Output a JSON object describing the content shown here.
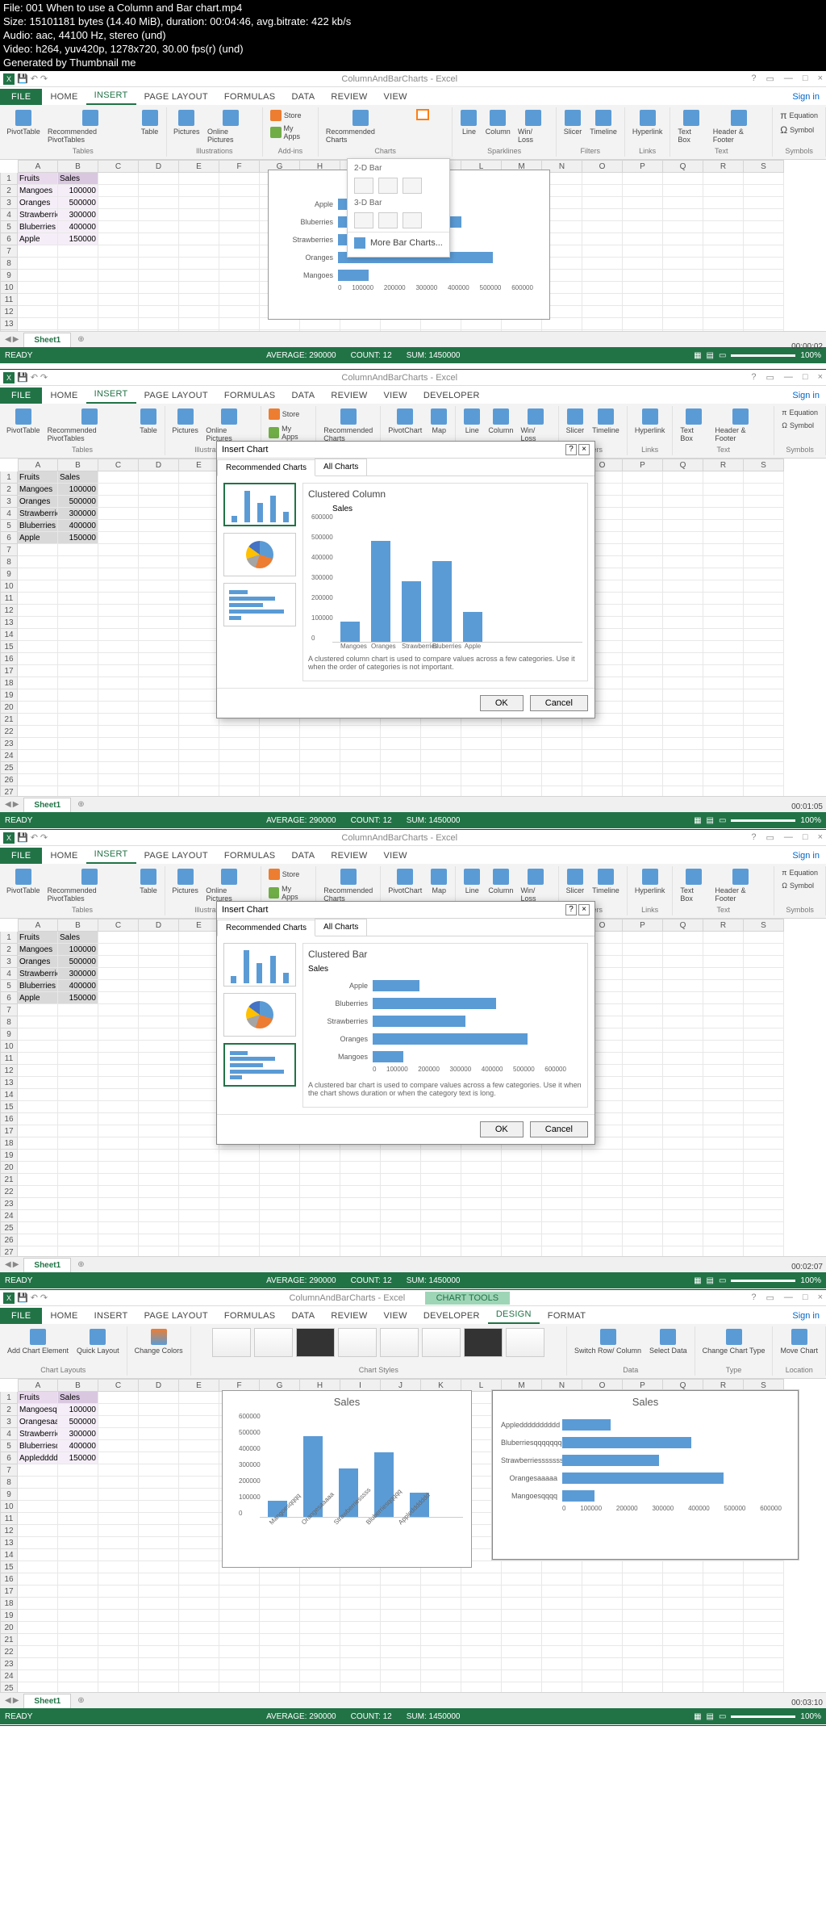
{
  "video_meta": {
    "file": "File: 001 When to use a Column and Bar chart.mp4",
    "size": "Size: 15101181 bytes (14.40 MiB), duration: 00:04:46, avg.bitrate: 422 kb/s",
    "audio": "Audio: aac, 44100 Hz, stereo (und)",
    "video": "Video: h264, yuv420p, 1278x720, 30.00 fps(r) (und)",
    "gen": "Generated by Thumbnail me"
  },
  "app_title": "ColumnAndBarCharts - Excel",
  "sign_in": "Sign in",
  "tabs_insert": {
    "file": "FILE",
    "home": "HOME",
    "insert": "INSERT",
    "pagelayout": "PAGE LAYOUT",
    "formulas": "FORMULAS",
    "data": "DATA",
    "review": "REVIEW",
    "view": "VIEW",
    "developer": "DEVELOPER"
  },
  "tabs_design": {
    "charttools": "CHART TOOLS",
    "design": "DESIGN",
    "format": "FORMAT"
  },
  "ribbon": {
    "groups": {
      "tables": "Tables",
      "illustrations": "Illustrations",
      "addins": "Add-ins",
      "charts": "Charts",
      "sparklines": "Sparklines",
      "filters": "Filters",
      "links": "Links",
      "text": "Text",
      "symbols": "Symbols",
      "data": "Data",
      "type": "Type",
      "location": "Location",
      "chartlayouts": "Chart Layouts",
      "chartstyles": "Chart Styles"
    },
    "btns": {
      "pivottable": "PivotTable",
      "recpivot": "Recommended PivotTables",
      "table": "Table",
      "pictures": "Pictures",
      "online": "Online Pictures",
      "store": "Store",
      "myapps": "My Apps",
      "reccharts": "Recommended Charts",
      "pivotchart": "PivotChart",
      "map": "Map",
      "line": "Line",
      "column": "Column",
      "winloss": "Win/ Loss",
      "slicer": "Slicer",
      "timeline": "Timeline",
      "hyperlink": "Hyperlink",
      "textbox": "Text Box",
      "header": "Header & Footer",
      "equation": "Equation",
      "symbol": "Symbol",
      "addchart": "Add Chart Element",
      "quicklayout": "Quick Layout",
      "changecolors": "Change Colors",
      "switchrowcol": "Switch Row/ Column",
      "selectdata": "Select Data",
      "changecharttype": "Change Chart Type",
      "movechart": "Move Chart"
    }
  },
  "chart_dd": {
    "bar2d": "2-D Bar",
    "bar3d": "3-D Bar",
    "more": "More Bar Charts..."
  },
  "columns": [
    "A",
    "B",
    "C",
    "D",
    "E",
    "F",
    "G",
    "H",
    "I",
    "J",
    "K",
    "L",
    "M",
    "N",
    "O",
    "P",
    "Q",
    "R",
    "S"
  ],
  "table_data": {
    "headers": [
      "Fruits",
      "Sales"
    ],
    "rows": [
      [
        "Mangoes",
        "100000"
      ],
      [
        "Oranges",
        "500000"
      ],
      [
        "Strawberries",
        "300000"
      ],
      [
        "Bluberries",
        "400000"
      ],
      [
        "Apple",
        "150000"
      ]
    ]
  },
  "table_data_long": {
    "headers": [
      "Fruits",
      "Sales"
    ],
    "rows": [
      [
        "Mangoesqqq",
        "100000"
      ],
      [
        "Orangesaaaa",
        "500000"
      ],
      [
        "Strawberries",
        "300000"
      ],
      [
        "Bluberriesqq",
        "400000"
      ],
      [
        "Appledddddc",
        "150000"
      ]
    ]
  },
  "chart_data": [
    {
      "panel": 1,
      "type": "bar",
      "title": "Sales",
      "categories": [
        "Apple",
        "Bluberries",
        "Strawberries",
        "Oranges",
        "Mangoes"
      ],
      "values": [
        150000,
        400000,
        300000,
        500000,
        100000
      ],
      "xlim": [
        0,
        600000
      ],
      "ticks": [
        "0",
        "100000",
        "200000",
        "300000",
        "400000",
        "500000",
        "600000"
      ]
    },
    {
      "panel": 2,
      "type": "bar_vertical",
      "title": "Sales",
      "chart_name": "Clustered Column",
      "categories": [
        "Mangoes",
        "Oranges",
        "Strawberries",
        "Bluberries",
        "Apple"
      ],
      "values": [
        100000,
        500000,
        300000,
        400000,
        150000
      ],
      "ylim": [
        0,
        600000
      ],
      "ticks": [
        "0",
        "100000",
        "200000",
        "300000",
        "400000",
        "500000",
        "600000"
      ],
      "desc": "A clustered column chart is used to compare values across a few categories. Use it when the order of categories is not important."
    },
    {
      "panel": 3,
      "type": "bar",
      "title": "Sales",
      "chart_name": "Clustered Bar",
      "categories": [
        "Apple",
        "Bluberries",
        "Strawberries",
        "Oranges",
        "Mangoes"
      ],
      "values": [
        150000,
        400000,
        300000,
        500000,
        100000
      ],
      "xlim": [
        0,
        600000
      ],
      "ticks": [
        "0",
        "100000",
        "200000",
        "300000",
        "400000",
        "500000",
        "600000"
      ],
      "desc": "A clustered bar chart is used to compare values across a few categories. Use it when the chart shows duration or when the category text is long."
    },
    {
      "panel": 4,
      "sub": "col",
      "type": "bar_vertical",
      "title": "Sales",
      "categories": [
        "Mangoesqqqq",
        "Orangesaaaaa",
        "Strawberriesssss",
        "Bluberriesqqqqq",
        "Appleddddddd"
      ],
      "values": [
        100000,
        500000,
        300000,
        400000,
        150000
      ],
      "ylim": [
        0,
        600000
      ],
      "ticks": [
        "0",
        "100000",
        "200000",
        "300000",
        "400000",
        "500000",
        "600000"
      ]
    },
    {
      "panel": 4,
      "sub": "bar",
      "type": "bar",
      "title": "Sales",
      "categories": [
        "Appledddddddddd",
        "Bluberriesqqqqqqqq",
        "Strawberriesssssss",
        "Orangesaaaaa",
        "Mangoesqqqq"
      ],
      "values": [
        150000,
        400000,
        300000,
        500000,
        100000
      ],
      "xlim": [
        0,
        600000
      ],
      "ticks": [
        "0",
        "100000",
        "200000",
        "300000",
        "400000",
        "500000",
        "600000"
      ]
    }
  ],
  "dialog": {
    "title": "Insert Chart",
    "tabs": {
      "rec": "Recommended Charts",
      "all": "All Charts"
    },
    "ok": "OK",
    "cancel": "Cancel"
  },
  "sheet": {
    "name": "Sheet1"
  },
  "status": {
    "ready": "READY",
    "average": "AVERAGE: 290000",
    "count": "COUNT: 12",
    "sum": "SUM: 1450000",
    "zoom": "100%"
  },
  "timestamps": {
    "p1": "00:00:02",
    "p2": "00:01:05",
    "p3": "00:02:07",
    "p4": "00:03:10"
  }
}
